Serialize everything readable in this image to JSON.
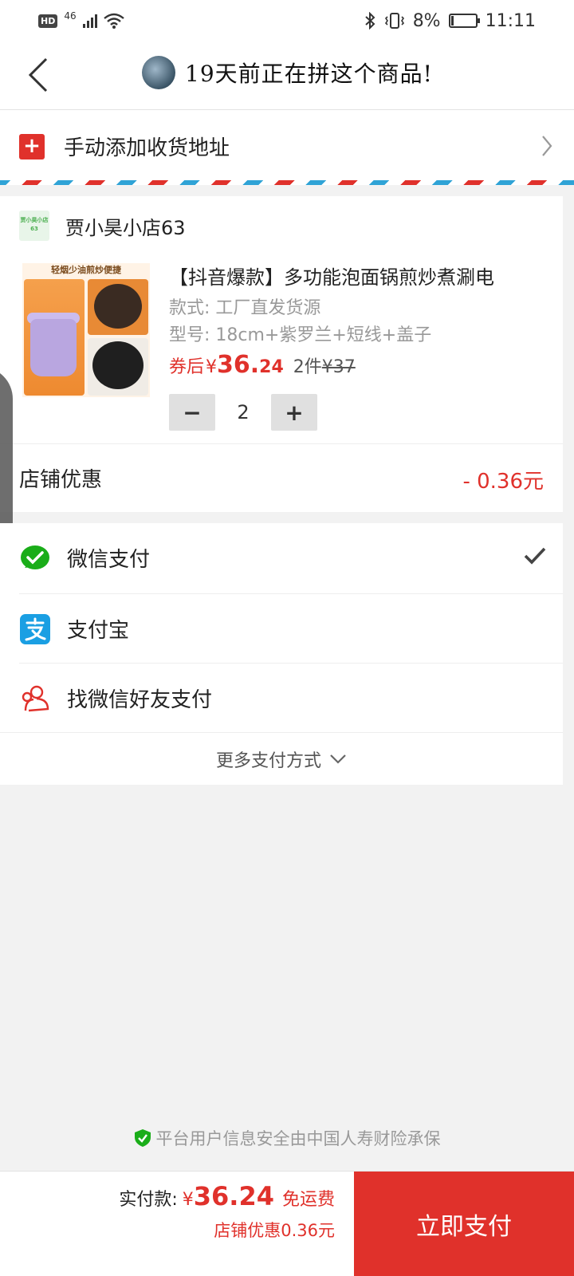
{
  "status_bar": {
    "hd": "HD",
    "network": "46",
    "battery": "8%",
    "time": "11:11"
  },
  "header": {
    "title": "19天前正在拼这个商品!"
  },
  "address": {
    "label": "手动添加收货地址",
    "plus": "+"
  },
  "shop": {
    "logo_text": "贾小昊小店63",
    "name": "贾小昊小店63"
  },
  "product": {
    "image_caption": "轻烟少油煎炒便捷",
    "title": "【抖音爆款】多功能泡面锅煎炒煮涮电",
    "spec_style": "款式: 工厂直发货源",
    "spec_model": "型号: 18cm+紫罗兰+短线+盖子",
    "price_label": "券后",
    "currency": "¥",
    "price_int": "36.",
    "price_dec": "24",
    "count_label": "2件",
    "original_price": "¥37",
    "quantity": "2",
    "minus": "−",
    "plus": "+"
  },
  "discount": {
    "label": "店铺优惠",
    "value": "- 0.36元"
  },
  "payment": {
    "options": [
      {
        "label": "微信支付",
        "icon": "wechat-pay-icon",
        "selected": true
      },
      {
        "label": "支付宝",
        "icon": "alipay-icon",
        "selected": false
      },
      {
        "label": "找微信好友支付",
        "icon": "friends-icon",
        "selected": false
      }
    ],
    "more_label": "更多支付方式"
  },
  "security_note": "平台用户信息安全由中国人寿财险承保",
  "bottom": {
    "total_label": "实付款:",
    "currency": "¥",
    "total": "36.24",
    "shipping": "免运费",
    "sub_discount": "店铺优惠0.36元",
    "pay_button": "立即支付"
  },
  "colors": {
    "accent": "#e0312b",
    "wechat_green": "#1aad19",
    "alipay_blue": "#1a9fe3",
    "airmail_blue": "#2fa3d6"
  }
}
